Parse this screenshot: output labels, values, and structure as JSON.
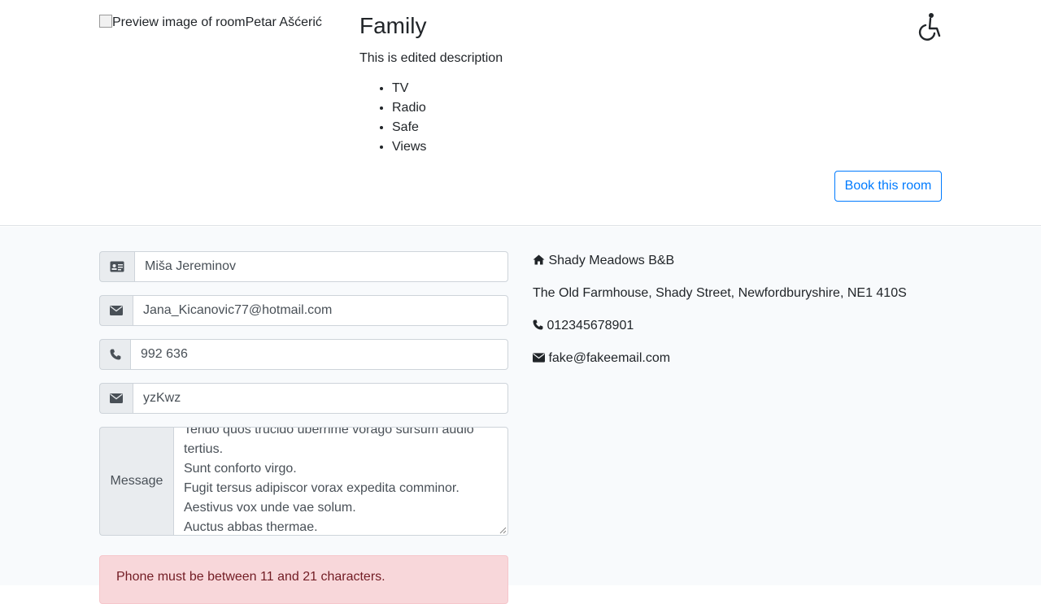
{
  "room": {
    "image_alt": "Preview image of roomPetar Ašćerić",
    "title": "Family",
    "description": "This is edited description",
    "amenities": [
      "TV",
      "Radio",
      "Safe",
      "Views"
    ],
    "book_label": "Book this room",
    "accessible_icon": "wheelchair-icon"
  },
  "form": {
    "name_value": "Miša Jereminov",
    "email_value": "Jana_Kicanovic77@hotmail.com",
    "phone_value": "992 636",
    "subject_value": "yzKwz",
    "message_label": "Message",
    "message_lines": [
      "Tendo quos trucido uberrime vorago sursum audio",
      "tertius.",
      "Sunt conforto virgo.",
      "Fugit tersus adipiscor vorax expedita comminor.",
      "Aestivus vox unde vae solum.",
      "Auctus abbas thermae."
    ],
    "error": "Phone must be between 11 and 21 characters.",
    "icons": [
      "id-card-icon",
      "envelope-icon",
      "phone-icon",
      "envelope-icon"
    ]
  },
  "contact_info": {
    "name": "Shady Meadows B&B",
    "address": "The Old Farmhouse, Shady Street, Newfordburyshire, NE1 410S",
    "phone": "012345678901",
    "email": "fake@fakeemail.com"
  },
  "colors": {
    "primary": "#007bff",
    "alert_bg": "#f8d7da",
    "alert_text": "#721c24",
    "section_bg": "#f8fafc"
  }
}
